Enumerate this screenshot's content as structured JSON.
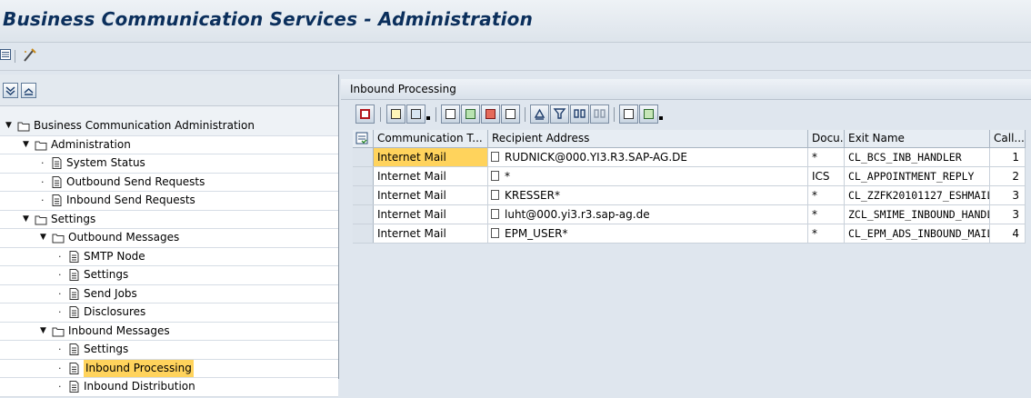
{
  "window": {
    "title": "Business Communication Services - Administration"
  },
  "app_toolbar": {
    "icons": [
      "list-icon",
      "wand-icon"
    ]
  },
  "tree": {
    "toolbar_icons": [
      "expand-all-icon",
      "collapse-all-icon"
    ],
    "rows": [
      {
        "label": "Business Communication Administration",
        "kind": "folder",
        "level": 0,
        "expanded": true
      },
      {
        "label": "Administration",
        "kind": "folder",
        "level": 1,
        "expanded": true
      },
      {
        "label": "System Status",
        "kind": "doc",
        "level": 2
      },
      {
        "label": "Outbound Send Requests",
        "kind": "doc",
        "level": 2
      },
      {
        "label": "Inbound Send Requests",
        "kind": "doc",
        "level": 2
      },
      {
        "label": "Settings",
        "kind": "folder",
        "level": 1,
        "expanded": true
      },
      {
        "label": "Outbound Messages",
        "kind": "folder",
        "level": 2,
        "expanded": true
      },
      {
        "label": "SMTP Node",
        "kind": "doc",
        "level": 3
      },
      {
        "label": "Settings",
        "kind": "doc",
        "level": 3
      },
      {
        "label": "Send Jobs",
        "kind": "doc",
        "level": 3
      },
      {
        "label": "Disclosures",
        "kind": "doc",
        "level": 3
      },
      {
        "label": "Inbound Messages",
        "kind": "folder",
        "level": 2,
        "expanded": true
      },
      {
        "label": "Settings",
        "kind": "doc",
        "level": 3
      },
      {
        "label": "Inbound Processing",
        "kind": "doc",
        "level": 3,
        "selected": true
      },
      {
        "label": "Inbound Distribution",
        "kind": "doc",
        "level": 3
      }
    ]
  },
  "panel": {
    "title": "Inbound Processing"
  },
  "grid": {
    "columns": [
      "Communication T...",
      "Recipient Address",
      "Docu...",
      "Exit Name",
      "Call..."
    ],
    "rows": [
      {
        "comm_type": "Internet Mail",
        "recipient": "RUDNICK@000.YI3.R3.SAP-AG.DE",
        "doc": "*",
        "exit": "CL_BCS_INB_HANDLER",
        "call": "1"
      },
      {
        "comm_type": "Internet Mail",
        "recipient": "*",
        "doc": "ICS",
        "exit": "CL_APPOINTMENT_REPLY",
        "call": "2"
      },
      {
        "comm_type": "Internet Mail",
        "recipient": "KRESSER*",
        "doc": "*",
        "exit": "CL_ZZFK20101127_ESHMAILI...",
        "call": "3"
      },
      {
        "comm_type": "Internet Mail",
        "recipient": "luht@000.yi3.r3.sap-ag.de",
        "doc": "*",
        "exit": "ZCL_SMIME_INBOUND_HANDL...",
        "call": "3"
      },
      {
        "comm_type": "Internet Mail",
        "recipient": "EPM_USER*",
        "doc": "*",
        "exit": "CL_EPM_ADS_INBOUND_MAIL",
        "call": "4"
      }
    ]
  },
  "colors": {
    "highlight": "#ffd35c",
    "title_text": "#0b2f5c"
  }
}
